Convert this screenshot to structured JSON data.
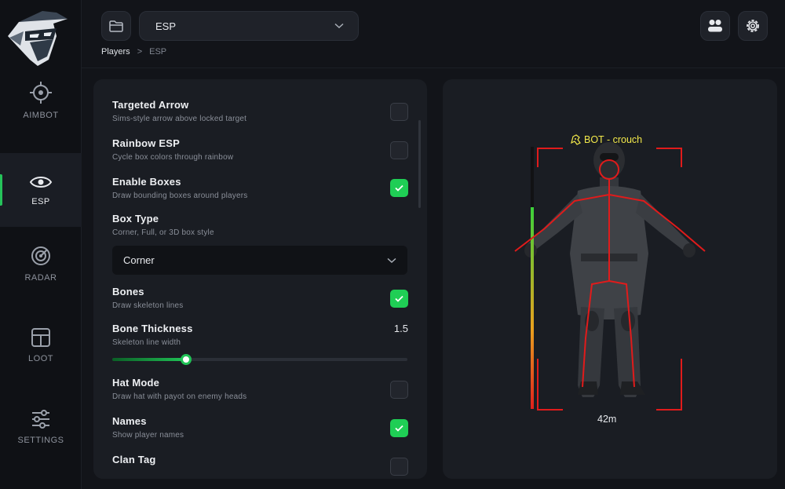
{
  "app": {
    "logo_icon": "ninja-mascot-logo",
    "accent_color": "#1fce55",
    "box_color": "#e01b1b",
    "label_color": "#f2e84a"
  },
  "sidebar": {
    "items": [
      {
        "label": "AIMBOT",
        "icon": "crosshair-icon",
        "active": false
      },
      {
        "label": "ESP",
        "icon": "eye-icon",
        "active": true
      },
      {
        "label": "RADAR",
        "icon": "radar-icon",
        "active": false
      },
      {
        "label": "LOOT",
        "icon": "layout-icon",
        "active": false
      },
      {
        "label": "SETTINGS",
        "icon": "sliders-icon",
        "active": false
      }
    ]
  },
  "header": {
    "folder_icon": "folder-icon",
    "selected_section": "ESP",
    "breadcrumb": {
      "root": "Players",
      "separator": ">",
      "current": "ESP"
    },
    "users_icon": "users-icon",
    "gear_icon": "gear-icon"
  },
  "settings": {
    "targeted_arrow": {
      "title": "Targeted Arrow",
      "desc": "Sims-style arrow above locked target",
      "checked": false
    },
    "rainbow_esp": {
      "title": "Rainbow ESP",
      "desc": "Cycle box colors through rainbow",
      "checked": false
    },
    "enable_boxes": {
      "title": "Enable Boxes",
      "desc": "Draw bounding boxes around players",
      "checked": true
    },
    "box_type": {
      "title": "Box Type",
      "desc": "Corner, Full, or 3D box style",
      "value": "Corner"
    },
    "bones": {
      "title": "Bones",
      "desc": "Draw skeleton lines",
      "checked": true
    },
    "bone_thickness": {
      "title": "Bone Thickness",
      "desc": "Skeleton line width",
      "value": "1.5",
      "fraction": 0.25
    },
    "hat_mode": {
      "title": "Hat Mode",
      "desc": "Draw hat with payot on enemy heads",
      "checked": false
    },
    "names": {
      "title": "Names",
      "desc": "Show player names",
      "checked": true
    },
    "clan_tag": {
      "title": "Clan Tag",
      "checked": false
    }
  },
  "preview": {
    "player_label": "BOT - crouch",
    "label_icon": "bot-icon",
    "distance": "42m",
    "health_fraction": 0.77
  }
}
